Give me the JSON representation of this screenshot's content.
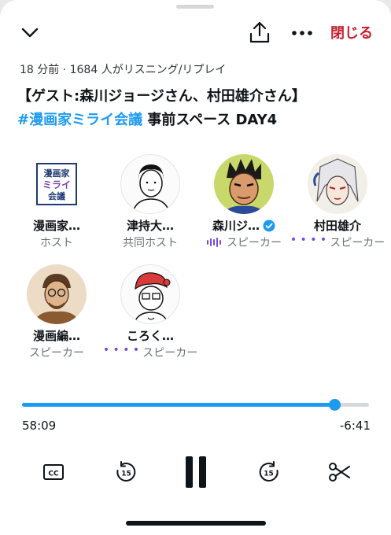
{
  "header": {
    "close_label": "閉じる",
    "icons": [
      "chevron-down-icon",
      "share-icon",
      "more-icon"
    ]
  },
  "space": {
    "meta": "18 分前 · 1684 人がリスニング/リプレイ",
    "title_line1": "【ゲスト:森川ジョージさん、村田雄介さん】",
    "title_hashtag": "#漫画家ミライ会議",
    "title_rest": " 事前スペース DAY4"
  },
  "participants": [
    {
      "name": "漫画家…",
      "role": "ホスト",
      "avatar_text": "漫画家ミライ会議",
      "speaking": false
    },
    {
      "name": "津持大…",
      "role": "共同ホスト",
      "speaking": false
    },
    {
      "name": "森川ジ…",
      "role": "スピーカー",
      "verified": true,
      "speaking": true
    },
    {
      "name": "村田雄介",
      "role": "スピーカー",
      "speaking": true
    },
    {
      "name": "漫画編…",
      "role": "スピーカー",
      "speaking": false
    },
    {
      "name": "ころく…",
      "role": "スピーカー",
      "speaking": true
    }
  ],
  "playback": {
    "elapsed": "58:09",
    "remaining": "-6:41",
    "progress": 0.9,
    "skip_seconds": "15"
  },
  "colors": {
    "accent": "#1d9bf0",
    "close": "#c4212f",
    "speaking": "#7a4ad6"
  }
}
